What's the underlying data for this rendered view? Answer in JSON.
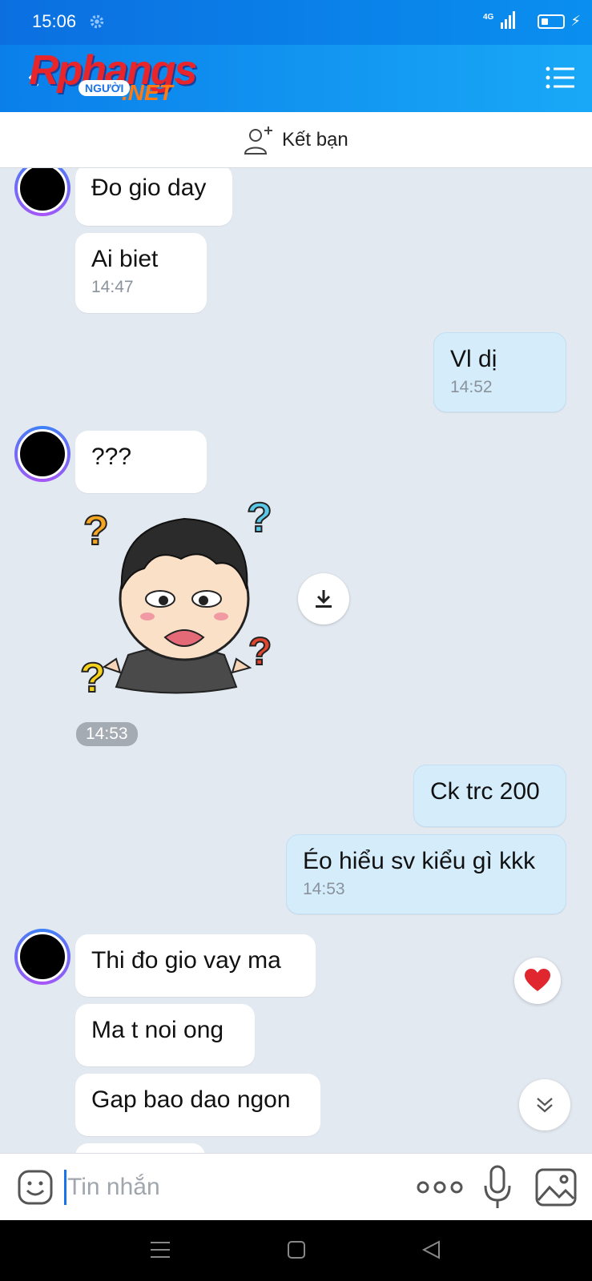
{
  "status_bar": {
    "time": "15:06",
    "network": "4G"
  },
  "header": {
    "logo_main": "Rphangs",
    "logo_badge": "NGƯỜI",
    "logo_suffix": ".NET"
  },
  "friend_bar": {
    "add_friend_label": "Kết bạn"
  },
  "messages": [
    {
      "dir": "in",
      "text": "Đo gio day",
      "time": ""
    },
    {
      "dir": "in",
      "text": "Ai biet",
      "time": "14:47"
    },
    {
      "dir": "out",
      "text": "Vl dị",
      "time": "14:52"
    },
    {
      "dir": "in",
      "text": "???",
      "time": ""
    },
    {
      "dir": "in",
      "type": "sticker",
      "time": "14:53"
    },
    {
      "dir": "out",
      "text": "Ck trc 200",
      "time": ""
    },
    {
      "dir": "out",
      "text": "Éo hiểu sv kiểu gì kkk",
      "time": "14:53"
    },
    {
      "dir": "in",
      "text": "Thi đo gio vay ma",
      "time": ""
    },
    {
      "dir": "in",
      "text": "Ma t noi ong",
      "time": ""
    },
    {
      "dir": "in",
      "text": "Gap bao dao ngon",
      "time": ""
    }
  ],
  "composer": {
    "placeholder": "Tin nhắn"
  },
  "colors": {
    "header": "#0a8fef",
    "outgoing_bubble": "#d5ecfb",
    "background": "#e3e9f1",
    "accent": "#1a73e8"
  }
}
